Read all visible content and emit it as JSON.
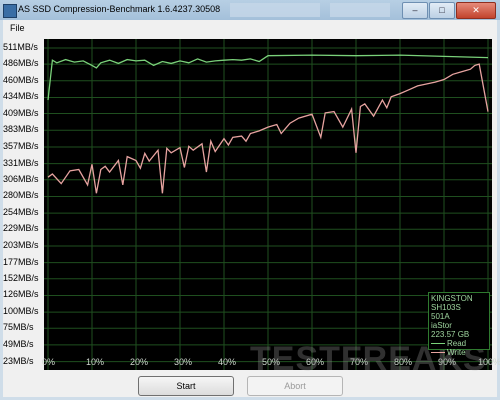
{
  "window": {
    "title": "AS SSD Compression-Benchmark 1.6.4237.30508",
    "buttons": {
      "minimize": "–",
      "maximize": "□",
      "close": "✕"
    }
  },
  "menu": {
    "file_label": "File"
  },
  "buttons": {
    "start_label": "Start",
    "abort_label": "Abort"
  },
  "watermark": "TESTFREAKS",
  "legend": {
    "device": "KINGSTON SH103S",
    "firmware": "501A",
    "driver": "iaStor",
    "size": "223.57 GB",
    "read_label": "Read",
    "write_label": "Write"
  },
  "colors": {
    "read": "#7ad17a",
    "write": "#e7a3a0",
    "grid": "#1f4f1f",
    "plot_bg": "#000000"
  },
  "chart_data": {
    "type": "line",
    "ylabels": [
      "511MB/s",
      "486MB/s",
      "460MB/s",
      "434MB/s",
      "409MB/s",
      "383MB/s",
      "357MB/s",
      "331MB/s",
      "306MB/s",
      "280MB/s",
      "254MB/s",
      "229MB/s",
      "203MB/s",
      "177MB/s",
      "152MB/s",
      "126MB/s",
      "100MB/s",
      "75MB/s",
      "49MB/s",
      "23MB/s"
    ],
    "xlabels": [
      "0%",
      "10%",
      "20%",
      "30%",
      "40%",
      "50%",
      "60%",
      "70%",
      "80%",
      "90%",
      "100%"
    ],
    "ylim": [
      10,
      525
    ],
    "xlim": [
      0,
      100
    ],
    "series": [
      {
        "name": "Read",
        "x": [
          0,
          1,
          2,
          4,
          6,
          8,
          10,
          11,
          12,
          14,
          16,
          18,
          20,
          22,
          24,
          26,
          28,
          30,
          32,
          34,
          36,
          38,
          40,
          42,
          44,
          46,
          48,
          50,
          60,
          70,
          80,
          90,
          100
        ],
        "y": [
          430,
          492,
          488,
          493,
          489,
          491,
          484,
          480,
          488,
          492,
          487,
          493,
          491,
          492,
          484,
          490,
          487,
          491,
          488,
          494,
          489,
          491,
          492,
          493,
          492,
          494,
          490,
          499,
          500,
          499,
          500,
          498,
          496
        ]
      },
      {
        "name": "Write",
        "x": [
          0,
          1,
          3,
          5,
          7,
          9,
          10,
          11,
          12,
          13,
          14,
          16,
          17,
          18,
          20,
          21,
          22,
          23,
          25,
          26,
          27,
          28,
          30,
          31,
          32,
          33,
          35,
          36,
          37,
          38,
          40,
          41,
          42,
          44,
          45,
          46,
          48,
          50,
          52,
          53,
          55,
          57,
          60,
          62,
          63,
          65,
          67,
          69,
          70,
          71,
          72,
          74,
          76,
          77,
          78,
          80,
          82,
          84,
          86,
          88,
          90,
          92,
          94,
          96,
          97,
          98,
          100
        ],
        "y": [
          310,
          315,
          300,
          320,
          322,
          298,
          330,
          285,
          322,
          327,
          318,
          336,
          298,
          342,
          336,
          324,
          347,
          335,
          352,
          285,
          355,
          348,
          356,
          325,
          358,
          352,
          362,
          318,
          366,
          350,
          370,
          360,
          372,
          374,
          366,
          378,
          382,
          388,
          392,
          378,
          394,
          402,
          408,
          372,
          410,
          412,
          388,
          416,
          348,
          420,
          424,
          405,
          430,
          418,
          435,
          440,
          446,
          452,
          455,
          458,
          462,
          470,
          474,
          478,
          484,
          486,
          412
        ]
      }
    ]
  }
}
